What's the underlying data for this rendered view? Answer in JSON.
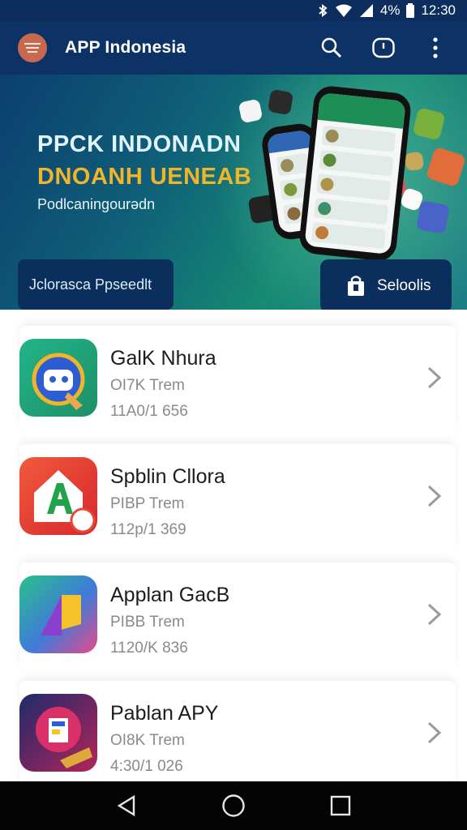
{
  "status_bar": {
    "battery": "4%",
    "time": "12:30"
  },
  "app_bar": {
    "title": "APP Indonesia",
    "icons": [
      "menu-icon",
      "search-icon",
      "timer-icon",
      "more-vert-icon"
    ]
  },
  "banner": {
    "headline_line1": "PPCK INDONADN",
    "headline_line2": "DNOANH UENEAB",
    "subline": "Podlcaningourədn",
    "tab_left_label": "Jclorasca Ppseedlt",
    "tab_right_label": "Seloolis",
    "colors": {
      "headline1": "#dff4ff",
      "headline2": "#f2b52a",
      "accent": "#1d8f56"
    }
  },
  "apps": [
    {
      "name": "GalK Nhura",
      "meta": "OI7K Trem",
      "date": "11A0/1 656",
      "icon": "robot-app-icon"
    },
    {
      "name": "Spblin Cllora",
      "meta": "PIBP Trem",
      "date": "112p/1 369",
      "icon": "letter-a-app-icon"
    },
    {
      "name": "Applan GacB",
      "meta": "PIBB Trem",
      "date": "1120/K 836",
      "icon": "gradient-shape-app-icon"
    },
    {
      "name": "Pablan APY",
      "meta": "OI8K Trem",
      "date": "4:30/1 026",
      "icon": "letter-f-app-icon"
    }
  ],
  "nav_bar": {
    "icons": [
      "back-icon",
      "home-icon",
      "recents-icon"
    ]
  }
}
